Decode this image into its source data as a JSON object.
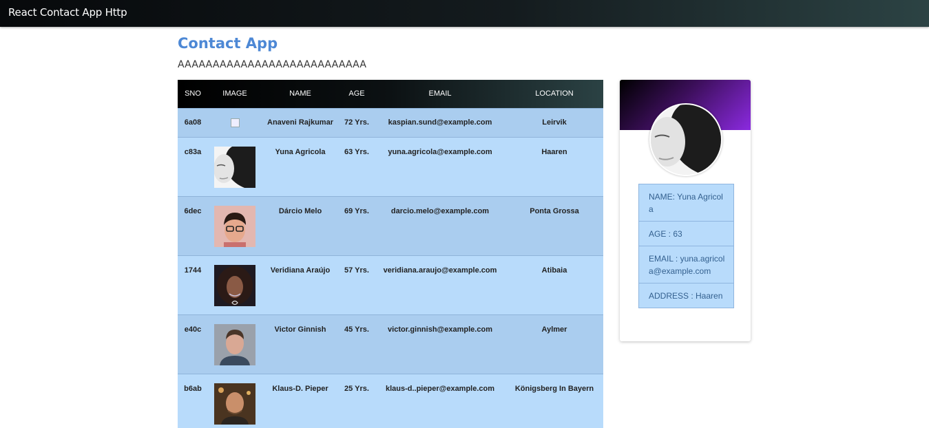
{
  "navbar": {
    "brand": "React Contact App Http"
  },
  "page": {
    "title": "Contact App",
    "subtitle": "AAAAAAAAAAAAAAAAAAAAAAAAAAA"
  },
  "table": {
    "headers": [
      "SNO",
      "IMAGE",
      "NAME",
      "AGE",
      "EMAIL",
      "LOCATION"
    ],
    "rows": [
      {
        "sno": "6a08",
        "name": "Anaveni Rajkumar",
        "age": "72 Yrs.",
        "email": "kaspian.sund@example.com",
        "location": "Leirvik",
        "image": "broken-image-icon"
      },
      {
        "sno": "c83a",
        "name": "Yuna Agricola",
        "age": "63 Yrs.",
        "email": "yuna.agricola@example.com",
        "location": "Haaren",
        "image": "woman-portrait-photo"
      },
      {
        "sno": "6dec",
        "name": "Dárcio Melo",
        "age": "69 Yrs.",
        "email": "darcio.melo@example.com",
        "location": "Ponta Grossa",
        "image": "man-glasses-photo"
      },
      {
        "sno": "1744",
        "name": "Veridiana Araújo",
        "age": "57 Yrs.",
        "email": "veridiana.araujo@example.com",
        "location": "Atibaia",
        "image": "woman-curly-hair-photo"
      },
      {
        "sno": "e40c",
        "name": "Victor Ginnish",
        "age": "45 Yrs.",
        "email": "victor.ginnish@example.com",
        "location": "Aylmer",
        "image": "man-portrait-photo"
      },
      {
        "sno": "b6ab",
        "name": "Klaus-D. Pieper",
        "age": "25 Yrs.",
        "email": "klaus-d..pieper@example.com",
        "location": "Königsberg In Bayern",
        "image": "man-bald-photo"
      }
    ]
  },
  "card": {
    "name": "NAME: Yuna Agricola",
    "age": "AGE : 63",
    "email": "EMAIL : yuna.agricola@example.com",
    "address": "ADDRESS : Haaren"
  },
  "colors": {
    "title": "#4d88d5",
    "row_odd": "#aacdef",
    "row_even": "#b8dbfb",
    "card_accent": "#8b2ae0"
  }
}
